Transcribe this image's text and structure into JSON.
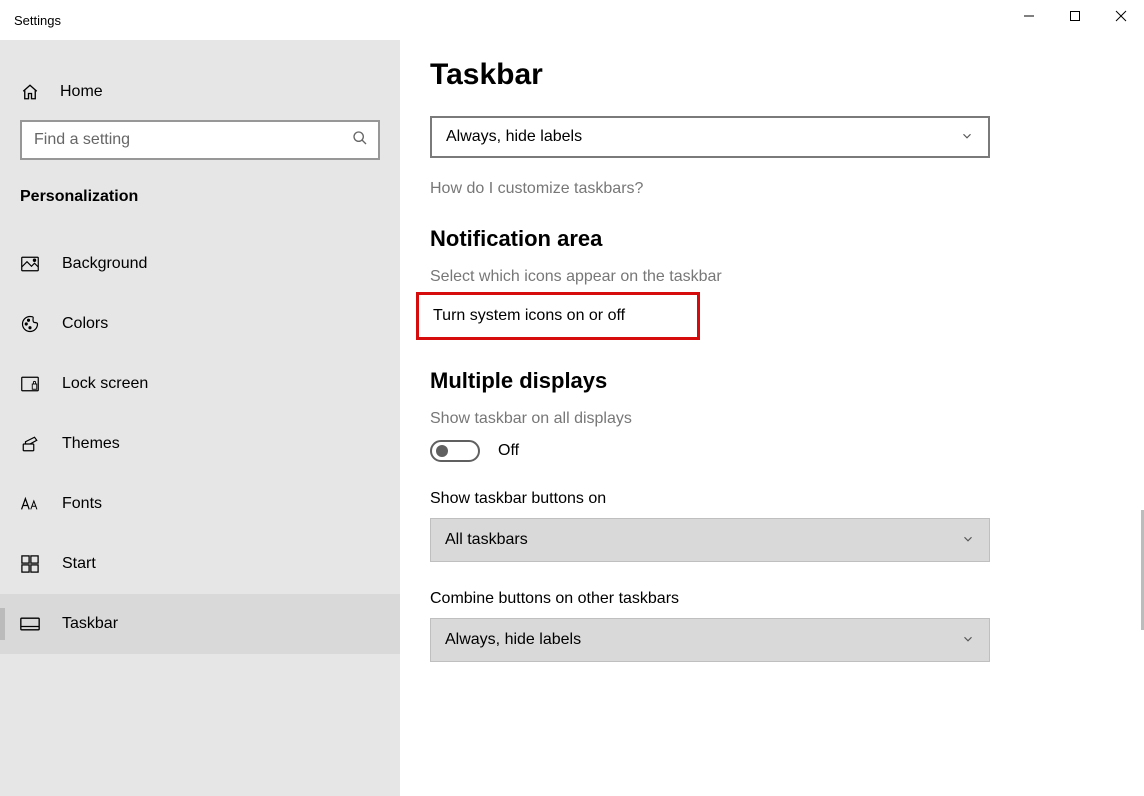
{
  "window": {
    "title": "Settings"
  },
  "sidebar": {
    "home": "Home",
    "search_placeholder": "Find a setting",
    "section": "Personalization",
    "items": [
      {
        "label": "Background"
      },
      {
        "label": "Colors"
      },
      {
        "label": "Lock screen"
      },
      {
        "label": "Themes"
      },
      {
        "label": "Fonts"
      },
      {
        "label": "Start"
      },
      {
        "label": "Taskbar"
      }
    ]
  },
  "main": {
    "title": "Taskbar",
    "combo_top": "Always, hide labels",
    "help_link": "How do I customize taskbars?",
    "section_notification": "Notification area",
    "link_select_icons": "Select which icons appear on the taskbar",
    "link_system_icons": "Turn system icons on or off",
    "section_multiple": "Multiple displays",
    "toggle_show_all_label": "Show taskbar on all displays",
    "toggle_state": "Off",
    "show_buttons_label": "Show taskbar buttons on",
    "show_buttons_value": "All taskbars",
    "combine_other_label": "Combine buttons on other taskbars",
    "combine_other_value": "Always, hide labels"
  }
}
